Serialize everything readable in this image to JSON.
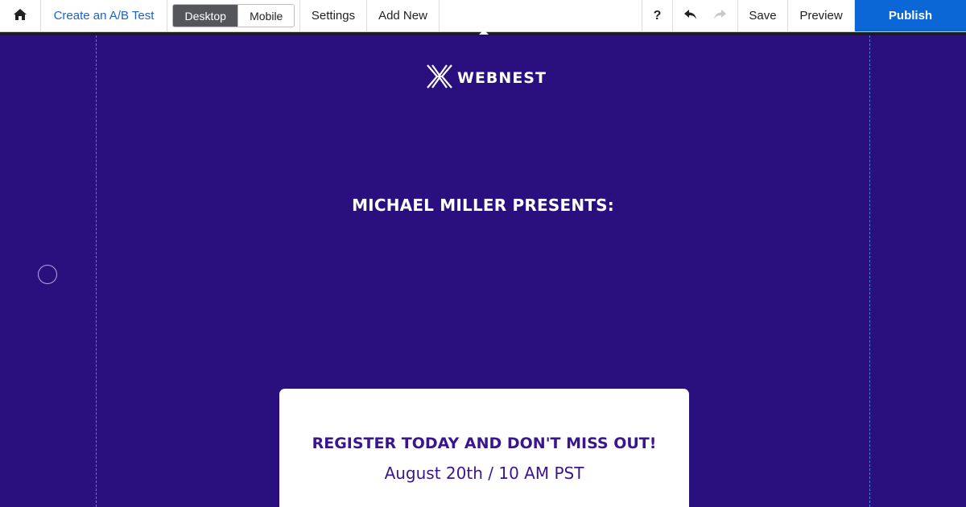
{
  "toolbar": {
    "home_icon": "home-icon",
    "ab_test_label": "Create an A/B Test",
    "view_modes": [
      "Desktop",
      "Mobile"
    ],
    "active_view": "Desktop",
    "settings_label": "Settings",
    "add_new_label": "Add New",
    "help_label": "?",
    "undo_icon": "undo-icon",
    "redo_icon": "redo-icon",
    "save_label": "Save",
    "preview_label": "Preview",
    "publish_label": "Publish"
  },
  "page": {
    "logo_text": "WEBNEST",
    "presents_text": "MICHAEL MILLER PRESENTS:",
    "card": {
      "headline": "REGISTER TODAY AND DON'T MISS OUT!",
      "date": "August 20th / 10 AM PST"
    }
  },
  "colors": {
    "canvas_background": "#2a0f7e",
    "publish_button": "#0b67d6",
    "active_segment": "#555659",
    "card_text": "#3a1590",
    "link_text": "#1a63c9"
  }
}
